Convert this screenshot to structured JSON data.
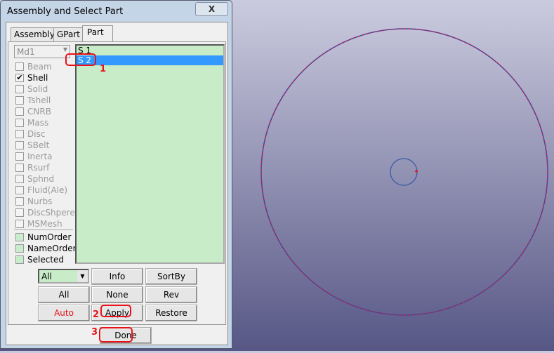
{
  "dialog": {
    "title": "Assembly and Select Part",
    "close": "X"
  },
  "tabs": [
    "Assembly",
    "GPart",
    "Part"
  ],
  "model_combo": "Md1",
  "types": [
    {
      "label": "Beam",
      "checked": false
    },
    {
      "label": "Shell",
      "checked": true
    },
    {
      "label": "Solid",
      "checked": false
    },
    {
      "label": "Tshell",
      "checked": false
    },
    {
      "label": "CNRB",
      "checked": false
    },
    {
      "label": "Mass",
      "checked": false
    },
    {
      "label": "Disc",
      "checked": false
    },
    {
      "label": "SBelt",
      "checked": false
    },
    {
      "label": "Inerta",
      "checked": false
    },
    {
      "label": "Rsurf",
      "checked": false
    },
    {
      "label": "Sphnd",
      "checked": false
    },
    {
      "label": "Fluid(Ale)",
      "checked": false
    },
    {
      "label": "Nurbs",
      "checked": false
    },
    {
      "label": "DiscShpere",
      "checked": false
    },
    {
      "label": "MSMesh",
      "checked": false
    }
  ],
  "order": [
    "NumOrder",
    "NameOrder",
    "Selected"
  ],
  "parts": [
    {
      "label": "S 1",
      "selected": false
    },
    {
      "label": "S 2",
      "selected": true
    }
  ],
  "filter_combo": "All",
  "buttons": {
    "info": "Info",
    "sortby": "SortBy",
    "all": "All",
    "none": "None",
    "rev": "Rev",
    "auto": "Auto",
    "apply": "Apply",
    "restore": "Restore",
    "done": "Done"
  },
  "annotations": [
    "1",
    "2",
    "3"
  ],
  "colors": {
    "circle": "#3a5aa8",
    "highlight": "#e8121a"
  }
}
